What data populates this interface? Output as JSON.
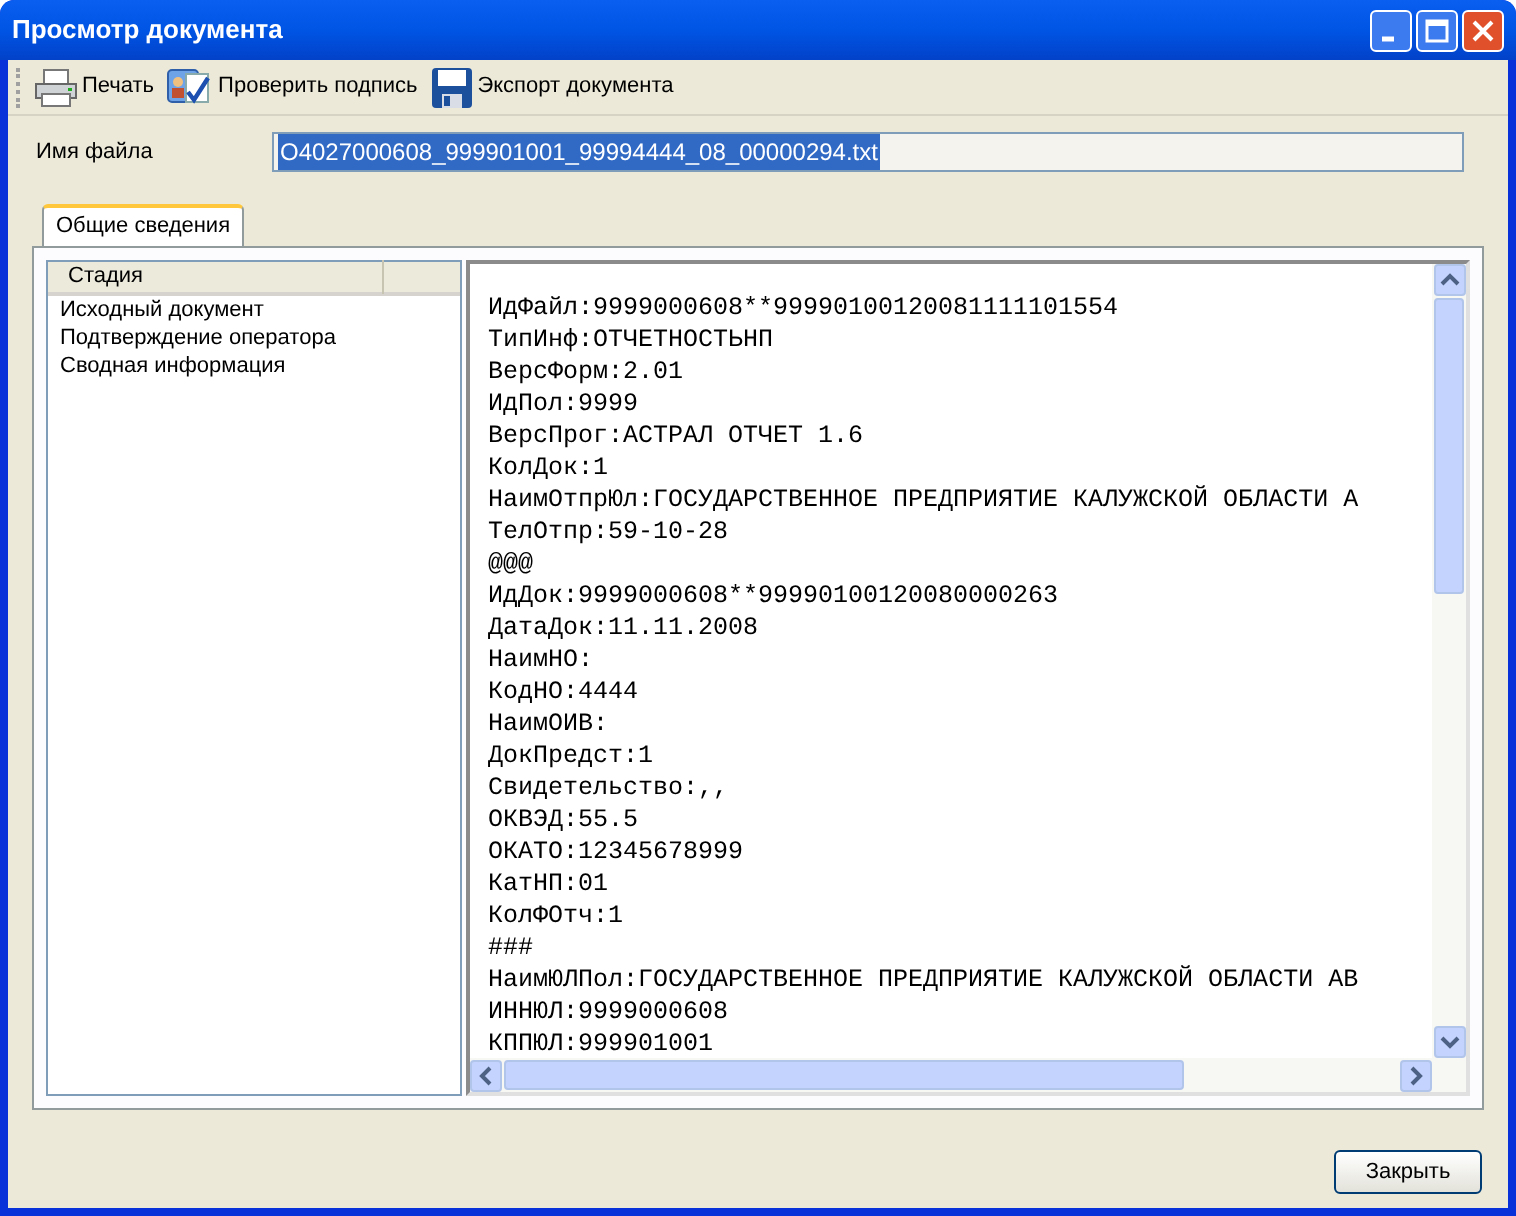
{
  "window": {
    "title": "Просмотр документа"
  },
  "toolbar": [
    {
      "kind": "print",
      "label": "Печать"
    },
    {
      "kind": "sign",
      "label": "Проверить подпись"
    },
    {
      "kind": "export",
      "label": "Экспорт документа"
    }
  ],
  "file_name": {
    "label": "Имя файла",
    "value": "O4027000608_999901001_99994444_08_00000294.txt",
    "value_selected": true
  },
  "tabs": [
    {
      "label": "Общие сведения",
      "selected": true
    }
  ],
  "stages": {
    "column": "Стадия",
    "items": [
      {
        "label": "Исходный документ"
      },
      {
        "label": "Подтверждение оператора"
      },
      {
        "label": "Сводная информация"
      }
    ]
  },
  "document_lines": [
    "ИдФайл:9999000608**99990100120081111101554",
    "ТипИнф:ОТЧЕТНОСТЬНП",
    "ВерсФорм:2.01",
    "ИдПол:9999",
    "ВерсПрог:АСТРАЛ ОТЧЕТ 1.6",
    "КолДок:1",
    "НаимОтпрЮл:ГОСУДАРСТВЕННОЕ ПРЕДПРИЯТИЕ КАЛУЖСКОЙ ОБЛАСТИ А",
    "ТелОтпр:59-10-28",
    "@@@",
    "ИдДок:9999000608**99990100120080000263",
    "ДатаДок:11.11.2008",
    "НаимНО:",
    "КодНО:4444",
    "НаимОИВ:",
    "ДокПредст:1",
    "Свидетельство:,,",
    "ОКВЭД:55.5",
    "ОКАТО:12345678999",
    "КатНП:01",
    "КолФОтч:1",
    "###",
    "НаимЮЛПол:ГОСУДАРСТВЕННОЕ ПРЕДПРИЯТИЕ КАЛУЖСКОЙ ОБЛАСТИ АВ",
    "ИННЮЛ:9999000608",
    "КППЮЛ:999901001"
  ],
  "buttons": [
    "Закрыть"
  ]
}
